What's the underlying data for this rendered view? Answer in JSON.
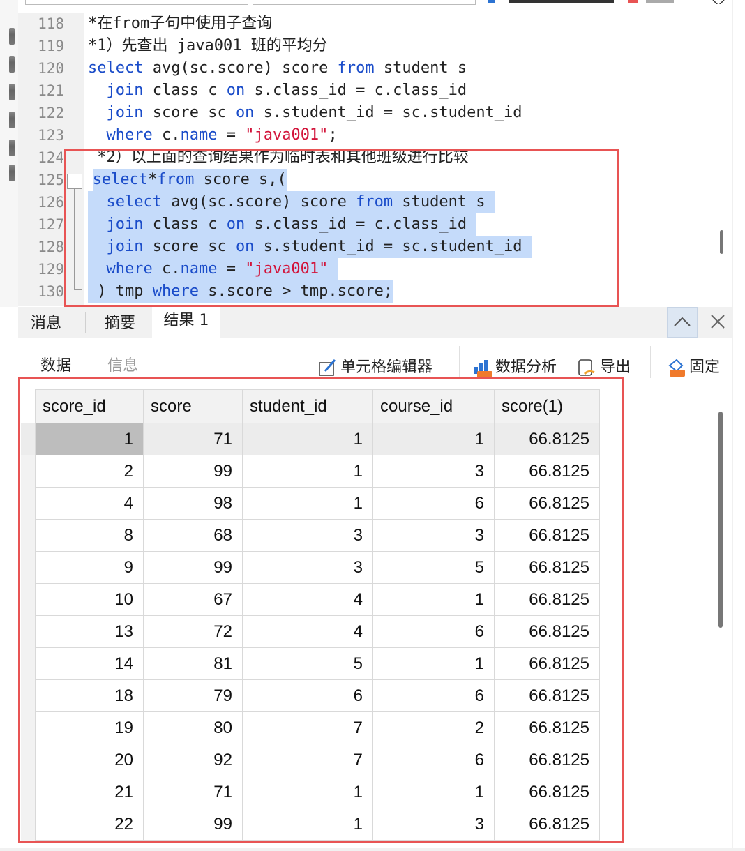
{
  "editor": {
    "lines": [
      {
        "num": "118",
        "indent": 4,
        "tokens": [
          {
            "t": "*在from子句中使用子查询",
            "c": "plain"
          }
        ]
      },
      {
        "num": "119",
        "indent": 4,
        "tokens": [
          {
            "t": "*1）先查出 java001 班的平均分",
            "c": "plain"
          }
        ]
      },
      {
        "num": "120",
        "indent": 4,
        "tokens": [
          {
            "t": "select",
            "c": "kw"
          },
          {
            "t": " avg(sc.score) score ",
            "c": "plain"
          },
          {
            "t": "from",
            "c": "kw"
          },
          {
            "t": " student s",
            "c": "plain"
          }
        ]
      },
      {
        "num": "121",
        "indent": 6,
        "tokens": [
          {
            "t": "join",
            "c": "kw"
          },
          {
            "t": " class c ",
            "c": "plain"
          },
          {
            "t": "on",
            "c": "kw"
          },
          {
            "t": " s.class_id = c.class_id",
            "c": "plain"
          }
        ]
      },
      {
        "num": "122",
        "indent": 6,
        "tokens": [
          {
            "t": "join",
            "c": "kw"
          },
          {
            "t": " score sc ",
            "c": "plain"
          },
          {
            "t": "on",
            "c": "kw"
          },
          {
            "t": " s.student_id = sc.student_id",
            "c": "plain"
          }
        ]
      },
      {
        "num": "123",
        "indent": 6,
        "tokens": [
          {
            "t": "where",
            "c": "kw"
          },
          {
            "t": " c.",
            "c": "plain"
          },
          {
            "t": "name",
            "c": "kw"
          },
          {
            "t": " = ",
            "c": "plain"
          },
          {
            "t": "\"java001\"",
            "c": "str"
          },
          {
            "t": ";",
            "c": "plain"
          }
        ]
      },
      {
        "num": "124",
        "indent": 5,
        "tokens": [
          {
            "t": "*2）以上面的查询结果作为临时表和其他班级进行比较",
            "c": "plain"
          }
        ]
      },
      {
        "num": "125",
        "indent": 4.5,
        "sel": true,
        "tokens": [
          {
            "t": "select",
            "c": "kw"
          },
          {
            "t": "*",
            "c": "plain"
          },
          {
            "t": "from",
            "c": "kw"
          },
          {
            "t": " score s,(",
            "c": "plain"
          }
        ]
      },
      {
        "num": "126",
        "indent": 4,
        "sel": true,
        "tokens": [
          {
            "t": "  select",
            "c": "kw"
          },
          {
            "t": " avg(sc.score) score ",
            "c": "plain"
          },
          {
            "t": "from",
            "c": "kw"
          },
          {
            "t": " student s ",
            "c": "plain"
          }
        ]
      },
      {
        "num": "127",
        "indent": 4,
        "sel": true,
        "tokens": [
          {
            "t": "  join",
            "c": "kw"
          },
          {
            "t": " class c ",
            "c": "plain"
          },
          {
            "t": "on",
            "c": "kw"
          },
          {
            "t": " s.class_id = c.class_id ",
            "c": "plain"
          }
        ]
      },
      {
        "num": "128",
        "indent": 4,
        "sel": true,
        "tokens": [
          {
            "t": "  join",
            "c": "kw"
          },
          {
            "t": " score sc ",
            "c": "plain"
          },
          {
            "t": "on",
            "c": "kw"
          },
          {
            "t": " s.student_id = sc.student_id ",
            "c": "plain"
          }
        ]
      },
      {
        "num": "129",
        "indent": 4,
        "sel": true,
        "tokens": [
          {
            "t": "  where",
            "c": "kw"
          },
          {
            "t": " c.",
            "c": "plain"
          },
          {
            "t": "name",
            "c": "kw"
          },
          {
            "t": " = ",
            "c": "plain"
          },
          {
            "t": "\"java001\"",
            "c": "str"
          },
          {
            "t": " ",
            "c": "plain"
          }
        ]
      },
      {
        "num": "130",
        "indent": 4,
        "sel": true,
        "tokens": [
          {
            "t": " ) tmp ",
            "c": "plain"
          },
          {
            "t": "where",
            "c": "kw"
          },
          {
            "t": " s.score > tmp.score;",
            "c": "plain"
          }
        ]
      }
    ]
  },
  "result_tabs": {
    "messages": "消息",
    "summary": "摘要",
    "result1": "结果 1"
  },
  "subtabs": {
    "data": "数据",
    "info": "信息"
  },
  "toolbar": {
    "cell_editor": "单元格编辑器",
    "data_analysis": "数据分析",
    "export": "导出",
    "pin": "固定"
  },
  "table": {
    "columns": [
      "score_id",
      "score",
      "student_id",
      "course_id",
      "score(1)"
    ],
    "rows": [
      [
        "1",
        "71",
        "1",
        "1",
        "66.8125"
      ],
      [
        "2",
        "99",
        "1",
        "3",
        "66.8125"
      ],
      [
        "4",
        "98",
        "1",
        "6",
        "66.8125"
      ],
      [
        "8",
        "68",
        "3",
        "3",
        "66.8125"
      ],
      [
        "9",
        "99",
        "3",
        "5",
        "66.8125"
      ],
      [
        "10",
        "67",
        "4",
        "1",
        "66.8125"
      ],
      [
        "13",
        "72",
        "4",
        "6",
        "66.8125"
      ],
      [
        "14",
        "81",
        "5",
        "1",
        "66.8125"
      ],
      [
        "18",
        "79",
        "6",
        "6",
        "66.8125"
      ],
      [
        "19",
        "80",
        "7",
        "2",
        "66.8125"
      ],
      [
        "20",
        "92",
        "7",
        "6",
        "66.8125"
      ],
      [
        "21",
        "71",
        "1",
        "1",
        "66.8125"
      ],
      [
        "22",
        "99",
        "1",
        "3",
        "66.8125"
      ]
    ]
  },
  "colors": {
    "keyword": "#1a4cc9",
    "string": "#d2143a",
    "selection": "#c5dbfa",
    "highlight_box": "#e85454",
    "accent": "#2c73d2"
  }
}
